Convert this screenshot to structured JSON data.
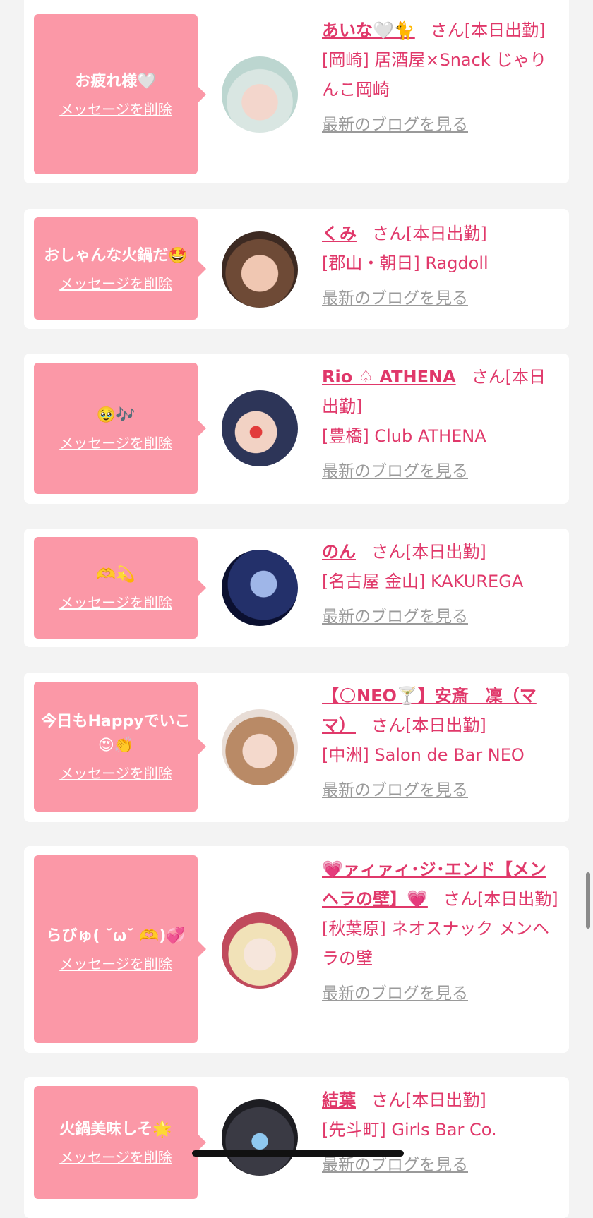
{
  "colors": {
    "bubble": "#fb98a7",
    "accent": "#e0386a",
    "muted": "#9a9a9a",
    "background": "#f3f3f3",
    "card": "#ffffff"
  },
  "common": {
    "delete_label": "メッセージを削除",
    "blog_label": "最新のブログを見る"
  },
  "cards": [
    {
      "message": "お疲れ様🤍",
      "name": "あいな🤍🐈",
      "san": "さん",
      "status": "[本日出勤]",
      "shop": "[岡崎] 居酒屋×Snack じゃりんこ岡崎",
      "avatar_icon": "avatar-photo"
    },
    {
      "message": "おしゃんな火鍋だ🤩",
      "name": "くみ",
      "san": "さん",
      "status": "[本日出勤]",
      "shop": "[郡山・朝日] Ragdoll",
      "avatar_icon": "avatar-photo"
    },
    {
      "message": "🥹🎶",
      "name": "Rio ♤ ATHENA",
      "san": "さん",
      "status": "[本日出勤]",
      "shop": "[豊橋] Club ATHENA",
      "avatar_icon": "avatar-photo"
    },
    {
      "message": "🫶💫",
      "name": "のん",
      "san": "さん",
      "status": "[本日出勤]",
      "shop": "[名古屋 金山] KAKUREGA",
      "avatar_icon": "avatar-photo"
    },
    {
      "message": "今日もHappyでいこ😍👏",
      "name": "【🌕NEO🍸】安斎　凜（ママ）",
      "san": "さん",
      "status": "[本日出勤]",
      "shop": "[中洲] Salon de Bar NEO",
      "avatar_icon": "avatar-photo"
    },
    {
      "message": "らびゅ( ˘ω˘ 🫶)💞",
      "name": "💗ァィァィ･ジ･エンド【メンヘラの壁】💗",
      "san": "さん",
      "status": "[本日出勤]",
      "shop": "[秋葉原] ネオスナック メンヘラの壁",
      "avatar_icon": "avatar-photo"
    },
    {
      "message": "火鍋美味しそ🌟",
      "name": "結葉",
      "san": "さん",
      "status": "[本日出勤]",
      "shop": "[先斗町] Girls Bar Co.",
      "avatar_icon": "avatar-photo"
    }
  ]
}
